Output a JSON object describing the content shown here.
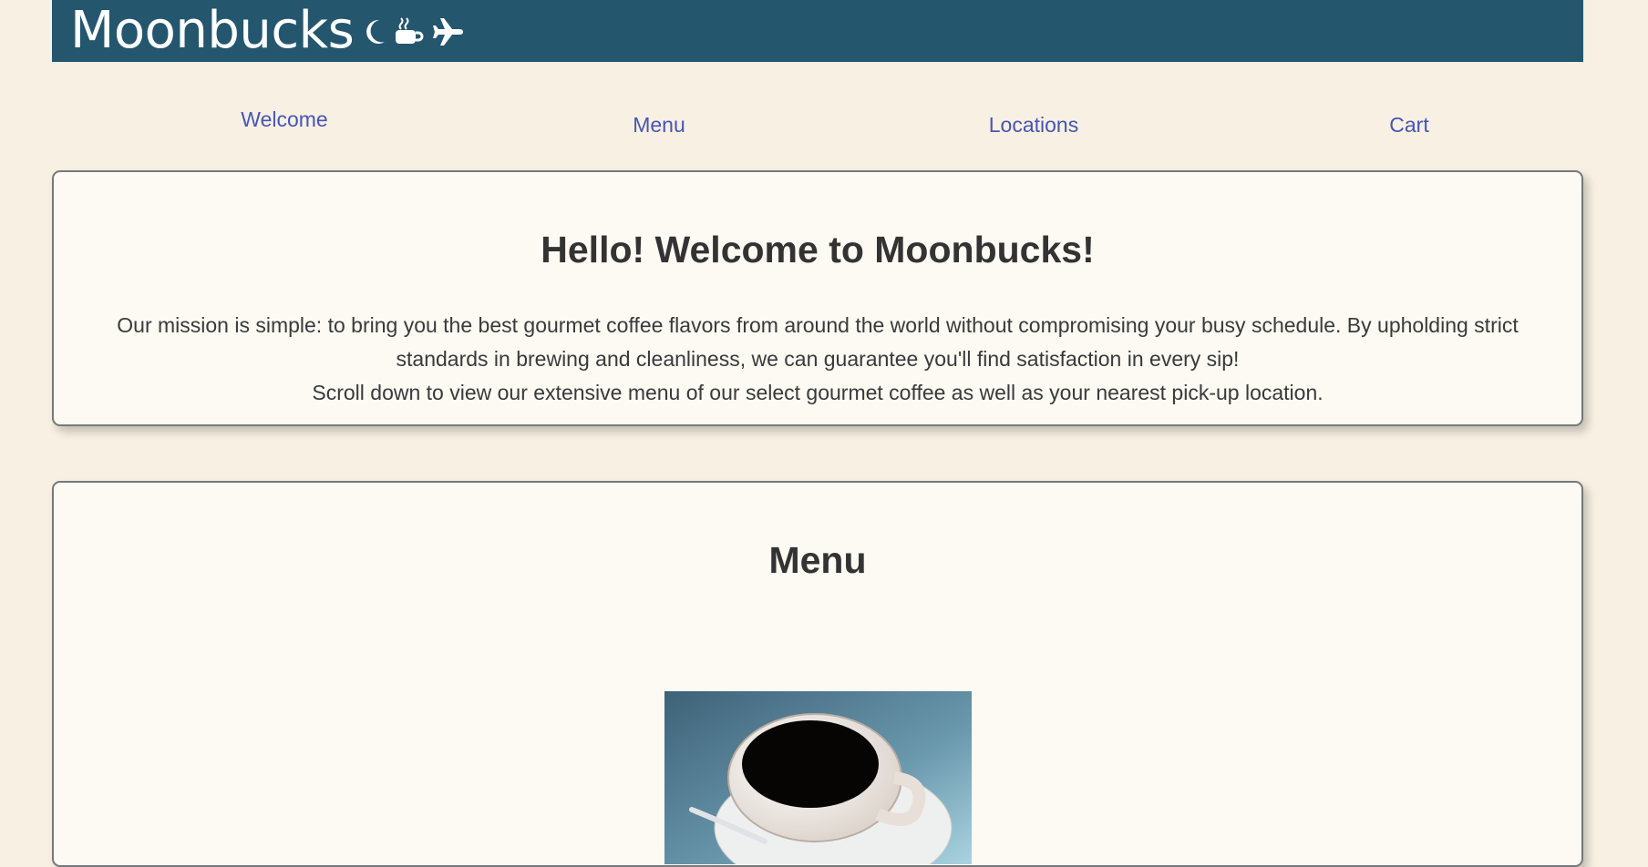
{
  "header": {
    "brand": "Moonbucks",
    "icons": [
      "moon-icon",
      "coffee-cup-icon",
      "airplane-icon"
    ],
    "background_color": "#24566e"
  },
  "nav": {
    "items": [
      {
        "label": "Welcome"
      },
      {
        "label": "Menu"
      },
      {
        "label": "Locations"
      },
      {
        "label": "Cart"
      }
    ],
    "link_color": "#4656b5"
  },
  "welcome": {
    "title": "Hello! Welcome to Moonbucks!",
    "line1": "Our mission is simple: to bring you the best gourmet coffee flavors from around the world without compromising your busy schedule. By upholding strict standards in brewing and cleanliness, we can guarantee you'll find satisfaction in every sip!",
    "line2": "Scroll down to view our extensive menu of our select gourmet coffee as well as your nearest pick-up location."
  },
  "menu": {
    "title": "Menu",
    "image": "coffee-cup-photo"
  },
  "colors": {
    "page_background": "#f8f0e2",
    "card_background": "#fdfaf4",
    "text": "#333333"
  }
}
